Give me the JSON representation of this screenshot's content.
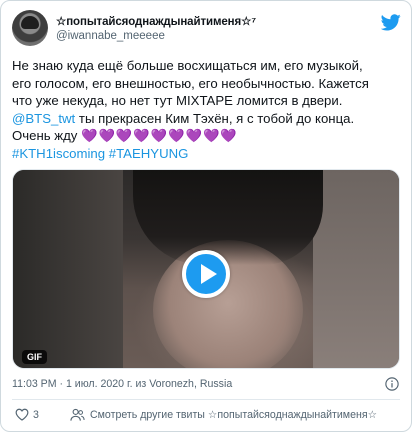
{
  "author": {
    "display_name": "☆попытайсяоднаждынайтименя☆⁷",
    "handle": "@iwannabe_meeeee"
  },
  "tweet": {
    "line1": "Не знаю куда ещё больше восхищаться им, его музыкой,",
    "line2": "его голосом, его внешностью, его необычностью. Кажется",
    "line3": "что уже некуда, но нет тут MIXTAPE ломится в двери.",
    "mention": "@BTS_twt",
    "line4_rest": " ты прекрасен Ким Тэхён, я с тобой до конца.",
    "line5_text": "Очень жду ",
    "hearts": "💜💜💜💜💜💜💜💜💜",
    "hashtag1": "#KTH1iscoming",
    "hashtag2": "#TAEHYUNG"
  },
  "media": {
    "badge": "GIF"
  },
  "meta": {
    "timestamp": "11:03 PM · 1 июл. 2020 г. из Voronezh, Russia"
  },
  "footer": {
    "like_count": "3",
    "more_tweets": "Смотреть другие твиты ☆попытайсяоднаждынайтименя☆"
  },
  "colors": {
    "accent": "#1d9bf0",
    "link": "#1b95e0",
    "secondary_text": "#536471"
  },
  "icons": [
    "twitter-bird-icon",
    "play-icon",
    "info-icon",
    "heart-icon",
    "people-icon"
  ]
}
